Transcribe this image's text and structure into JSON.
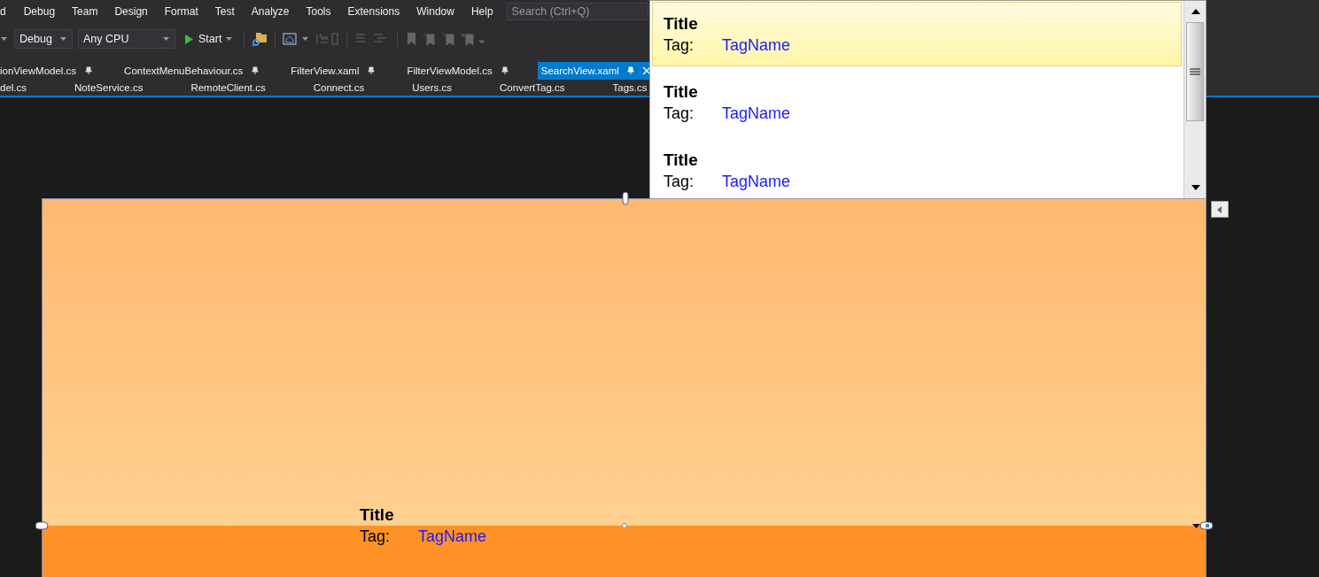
{
  "menu": [
    {
      "label": "d"
    },
    {
      "label": "Debug"
    },
    {
      "label": "Team"
    },
    {
      "label": "Design"
    },
    {
      "label": "Format"
    },
    {
      "label": "Test"
    },
    {
      "label": "Analyze"
    },
    {
      "label": "Tools"
    },
    {
      "label": "Extensions"
    },
    {
      "label": "Window"
    },
    {
      "label": "Help"
    }
  ],
  "search": {
    "placeholder": "Search (Ctrl+Q)"
  },
  "toolbar": {
    "configuration": "Debug",
    "platform": "Any CPU",
    "start": "Start"
  },
  "tab_rows": [
    [
      {
        "label": "ionViewModel.cs",
        "pinned": true,
        "selected": false
      },
      {
        "label": "ContextMenuBehaviour.cs",
        "pinned": true,
        "selected": false
      },
      {
        "label": "FilterView.xaml",
        "pinned": true,
        "selected": false
      },
      {
        "label": "FilterViewModel.cs",
        "pinned": true,
        "selected": false
      },
      {
        "label": "SearchView.xaml",
        "pinned": true,
        "selected": true
      }
    ],
    [
      {
        "label": "del.cs",
        "pinned": false,
        "selected": false
      },
      {
        "label": "NoteService.cs",
        "pinned": false,
        "selected": false
      },
      {
        "label": "RemoteClient.cs",
        "pinned": false,
        "selected": false
      },
      {
        "label": "Connect.cs",
        "pinned": false,
        "selected": false
      },
      {
        "label": "Users.cs",
        "pinned": false,
        "selected": false
      },
      {
        "label": "ConvertTag.cs",
        "pinned": false,
        "selected": false
      },
      {
        "label": "Tags.cs",
        "pinned": false,
        "selected": false
      }
    ]
  ],
  "popup": {
    "items": [
      {
        "title": "Title",
        "tag_label": "Tag:",
        "tag_value": "TagName",
        "selected": true
      },
      {
        "title": "Title",
        "tag_label": "Tag:",
        "tag_value": "TagName",
        "selected": false
      },
      {
        "title": "Title",
        "tag_label": "Tag:",
        "tag_value": "TagName",
        "selected": false
      }
    ]
  },
  "designer": {
    "item": {
      "title": "Title",
      "tag_label": "Tag:",
      "tag_value": "TagName"
    }
  }
}
